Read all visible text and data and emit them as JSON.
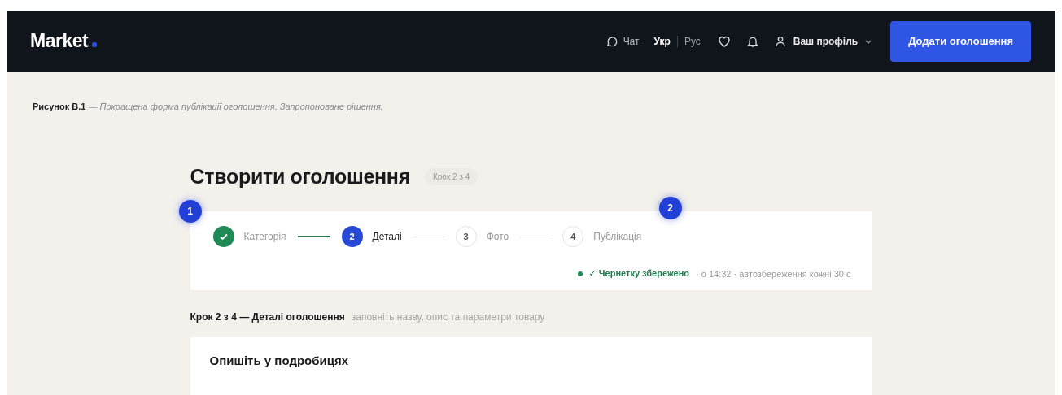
{
  "header": {
    "logo": "Market",
    "chat": "Чат",
    "languages": [
      {
        "label": "Укр",
        "selected": true
      },
      {
        "label": "Рус",
        "selected": false
      }
    ],
    "profile": "Ваш профіль",
    "action": "Додати оголошення"
  },
  "caption": {
    "label": "Рисунок В.1",
    "separator": "—",
    "text": "Покращена форма публікації оголошення. Запропоноване рішення."
  },
  "page": {
    "title": "Створити оголошення",
    "badge": "Крок 2 з 4"
  },
  "markers": [
    {
      "label": "1"
    },
    {
      "label": "2"
    }
  ],
  "steps": [
    {
      "label": "Категорія",
      "done": true,
      "selected": false
    },
    {
      "number": "2",
      "label": "Деталі",
      "done": false,
      "selected": true
    },
    {
      "number": "3",
      "label": "Фото",
      "done": false,
      "selected": false
    },
    {
      "number": "4",
      "label": "Публікація",
      "done": false,
      "selected": false
    }
  ],
  "save_status": {
    "saved": true,
    "label": "✓ Чернетку збережено",
    "detail": "· о 14:32 · автозбереження кожні 30 с"
  },
  "section": {
    "title": "Крок 2 з 4 — Деталі оголошення",
    "hint": "заповніть назву, опис та параметри товару"
  },
  "details_card": {
    "title": "Опишіть у подробицях"
  }
}
